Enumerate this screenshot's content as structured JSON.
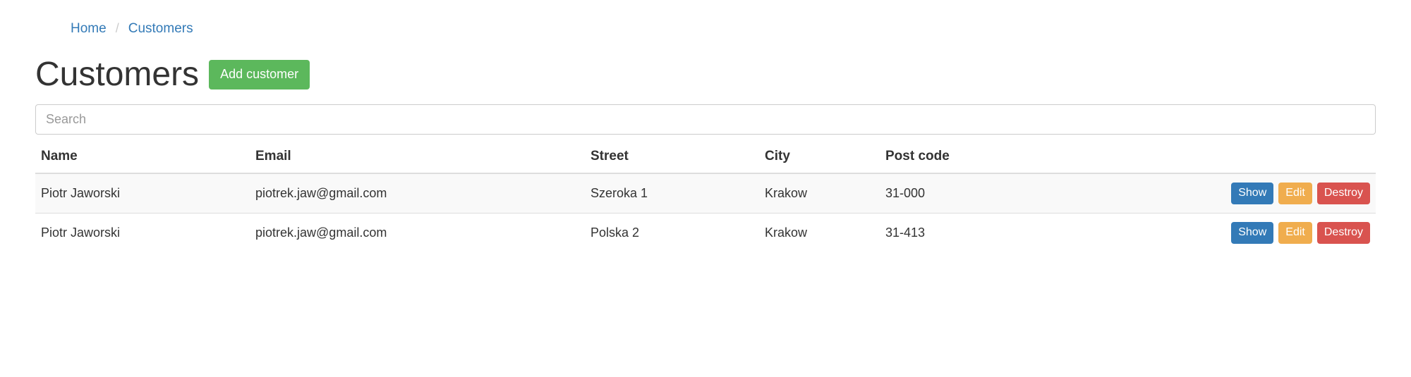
{
  "breadcrumb": {
    "home": "Home",
    "customers": "Customers"
  },
  "page_title": "Customers",
  "add_button_label": "Add customer",
  "search": {
    "placeholder": "Search"
  },
  "table": {
    "headers": {
      "name": "Name",
      "email": "Email",
      "street": "Street",
      "city": "City",
      "post_code": "Post code"
    },
    "actions": {
      "show": "Show",
      "edit": "Edit",
      "destroy": "Destroy"
    },
    "rows": [
      {
        "name": "Piotr Jaworski",
        "email": "piotrek.jaw@gmail.com",
        "street": "Szeroka 1",
        "city": "Krakow",
        "post_code": "31-000"
      },
      {
        "name": "Piotr Jaworski",
        "email": "piotrek.jaw@gmail.com",
        "street": "Polska 2",
        "city": "Krakow",
        "post_code": "31-413"
      }
    ]
  }
}
